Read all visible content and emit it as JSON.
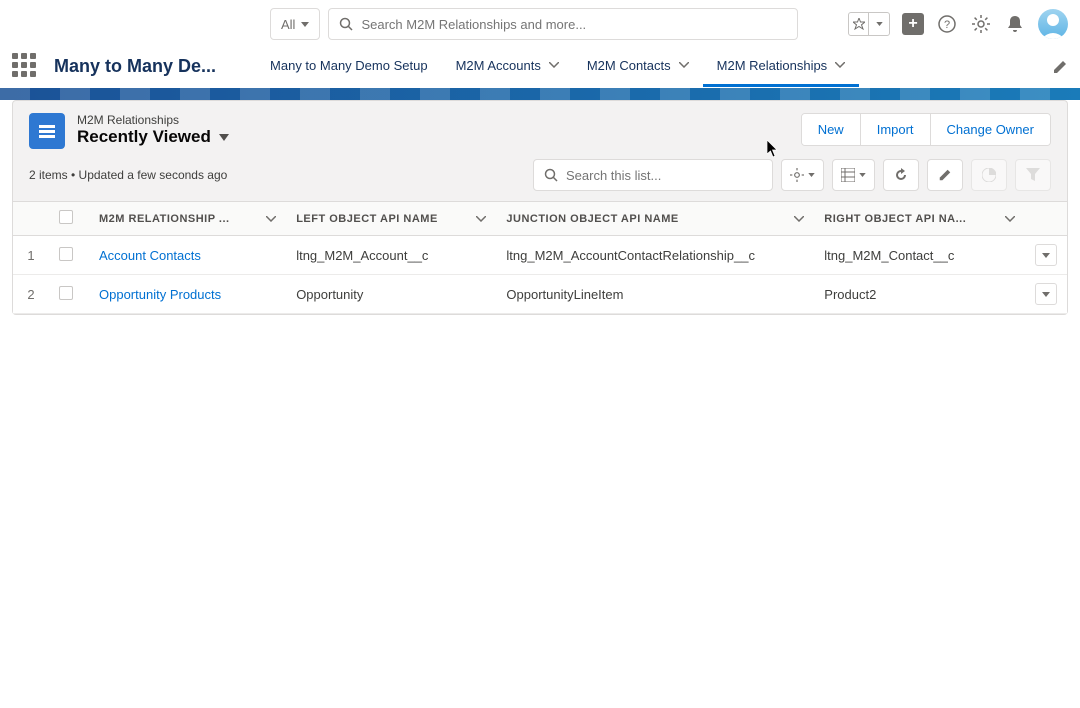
{
  "global": {
    "scope_label": "All",
    "search_placeholder": "Search M2M Relationships and more..."
  },
  "app": {
    "name": "Many to Many De...",
    "tabs": [
      {
        "label": "Many to Many Demo Setup",
        "has_menu": false,
        "active": false
      },
      {
        "label": "M2M Accounts",
        "has_menu": true,
        "active": false
      },
      {
        "label": "M2M Contacts",
        "has_menu": true,
        "active": false
      },
      {
        "label": "M2M Relationships",
        "has_menu": true,
        "active": true
      }
    ]
  },
  "list": {
    "object_label": "M2M Relationships",
    "view_name": "Recently Viewed",
    "status": "2 items • Updated a few seconds ago",
    "actions": {
      "new": "New",
      "import": "Import",
      "change_owner": "Change Owner"
    },
    "search_placeholder": "Search this list...",
    "columns": {
      "name": "M2M RELATIONSHIP ...",
      "left": "LEFT OBJECT API NAME",
      "junction": "JUNCTION OBJECT API NAME",
      "right": "RIGHT OBJECT API NA..."
    },
    "rows": [
      {
        "num": "1",
        "name": "Account Contacts",
        "left": "ltng_M2M_Account__c",
        "junction": "ltng_M2M_AccountContactRelationship__c",
        "right": "ltng_M2M_Contact__c"
      },
      {
        "num": "2",
        "name": "Opportunity Products",
        "left": "Opportunity",
        "junction": "OpportunityLineItem",
        "right": "Product2"
      }
    ]
  }
}
